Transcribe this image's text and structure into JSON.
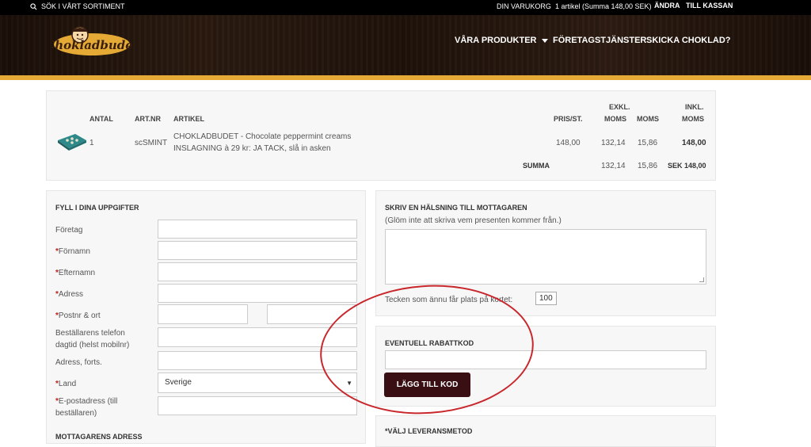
{
  "topbar": {
    "search_label": "SÖK I VÅRT SORTIMENT",
    "cart_title": "DIN VARUKORG",
    "cart_summary": "1 artikel (Summa 148,00 SEK)",
    "edit_label": "ÄNDRA",
    "checkout_label": "TILL KASSAN"
  },
  "header": {
    "logo_text": "Chokladbudet",
    "nav": [
      {
        "label": "VÅRA PRODUKTER"
      },
      {
        "label": "FÖRETAGSTJÄNSTER"
      },
      {
        "label": "SKICKA CHOKLAD?"
      }
    ]
  },
  "cart": {
    "headers": {
      "qty": "ANTAL",
      "artnr": "ART.NR",
      "article": "ARTIKEL",
      "price": "PRIS/ST.",
      "excl_1": "EXKL.",
      "excl_2": "MOMS",
      "vat": "MOMS",
      "incl_1": "INKL.",
      "incl_2": "MOMS"
    },
    "row": {
      "qty": "1",
      "artnr": "scSMINT",
      "article_line1": "CHOKLADBUDET - Chocolate peppermint creams",
      "article_line2": "INSLAGNING à 29 kr: JA TACK, slå in asken",
      "price": "148,00",
      "excl": "132,14",
      "vat": "15,86",
      "incl": "148,00"
    },
    "sum": {
      "label": "SUMMA",
      "excl": "132,14",
      "vat": "15,86",
      "incl": "SEK 148,00"
    }
  },
  "details": {
    "title": "FYLL I DINA UPPGIFTER",
    "fields": {
      "company": "Företag",
      "firstname": "Förnamn",
      "lastname": "Efternamn",
      "address": "Adress",
      "postal": "Postnr & ort",
      "phone_1": "Beställarens telefon",
      "phone_2": "dagtid (helst mobilnr)",
      "address2": "Adress, forts.",
      "country": "Land",
      "email_1": "E-postadress (till",
      "email_2": "beställaren)"
    },
    "country_value": "Sverige",
    "required_mark": "*",
    "next_section": "MOTTAGARENS ADRESS"
  },
  "greeting": {
    "title": "SKRIV EN HÄLSNING TILL MOTTAGAREN",
    "hint": "(Glöm inte att skriva vem presenten kommer från.)",
    "counter_label": "Tecken som ännu får plats på kortet:",
    "counter_value": "100"
  },
  "discount": {
    "title": "EVENTUELL RABATTKOD",
    "button": "LÄGG TILL KOD"
  },
  "delivery": {
    "title": "VÄLJ LEVERANSMETOD",
    "required_mark": "*"
  },
  "colors": {
    "accent_gold": "#e4aa35",
    "button_bg": "#3a0f14",
    "required_red": "#c0201c",
    "annotation_red": "#c8272c"
  }
}
